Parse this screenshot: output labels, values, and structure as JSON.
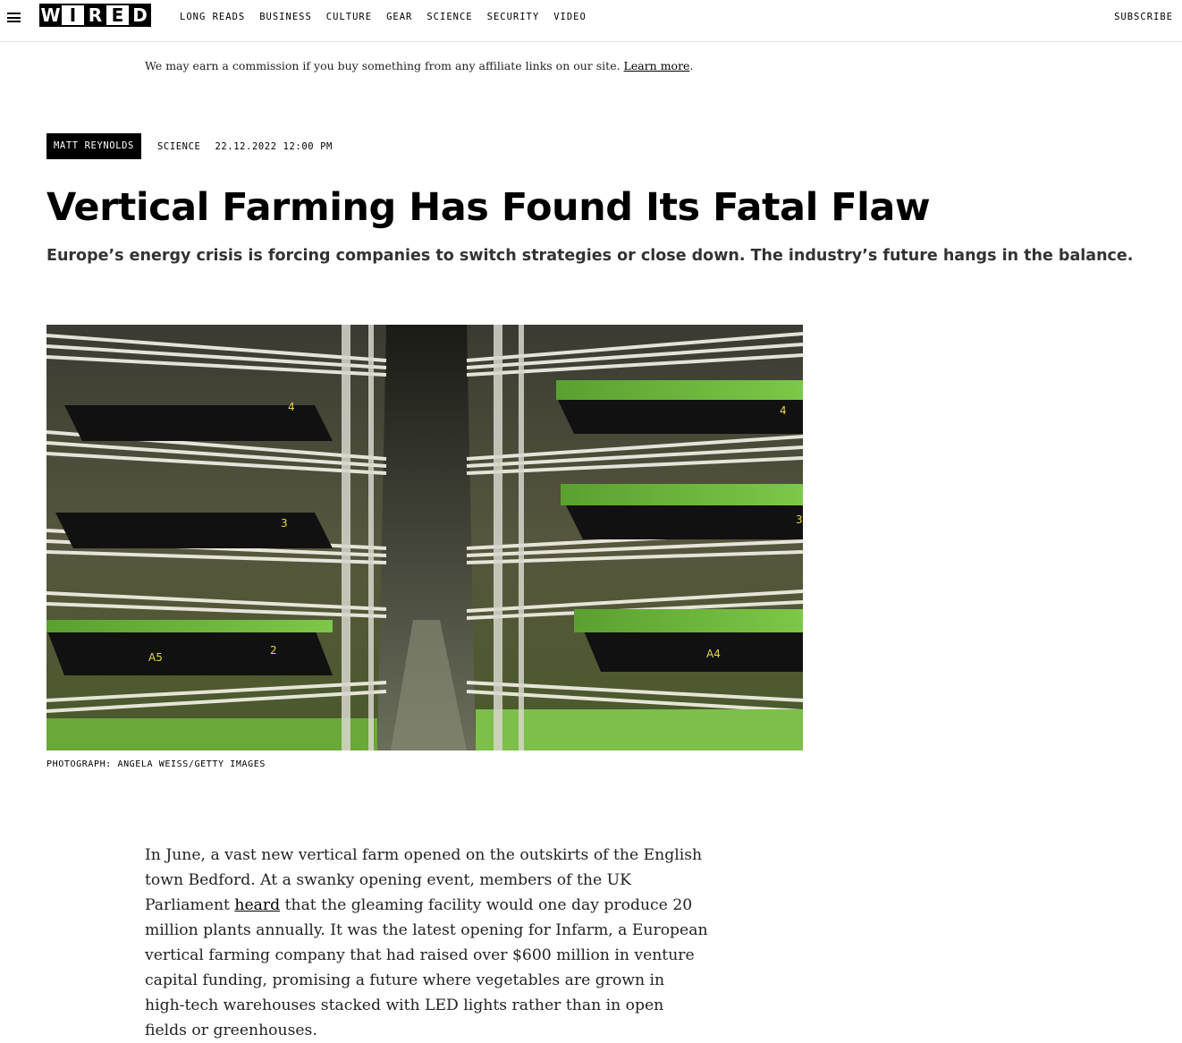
{
  "nav": {
    "menu_icon": "hamburger-icon",
    "logo_letters": [
      "W",
      "I",
      "R",
      "E",
      "D"
    ],
    "items": [
      "LONG READS",
      "BUSINESS",
      "CULTURE",
      "GEAR",
      "SCIENCE",
      "SECURITY",
      "VIDEO"
    ],
    "subscribe": "SUBSCRIBE"
  },
  "affiliate": {
    "text": "We may earn a commission if you buy something from any affiliate links on our site.",
    "link": "Learn more",
    "end": "."
  },
  "article": {
    "author": "MATT REYNOLDS",
    "rubric": "SCIENCE",
    "date": "22.12.2022 12:00 PM",
    "title": "Vertical Farming Has Found Its Fatal Flaw",
    "dek": "Europe’s energy crisis is forcing companies to switch strategies or close down. The industry’s future hangs in the balance.",
    "caption": "PHOTOGRAPH: ANGELA WEISS/GETTY IMAGES",
    "body_before": "In June, a vast new vertical farm opened on the outskirts of the English town Bedford. At a swanky opening event, members of the UK Parliament ",
    "body_link": "heard",
    "body_after": " that the gleaming facility would one day produce 20 million plants annually. It was the latest opening for Infarm, a European vertical farming company that had raised over $600 million in venture capital funding, promising a future where vegetables are grown in high-tech warehouses stacked with LED lights rather than in open fields or greenhouses."
  },
  "hero_labels": [
    "4",
    "3",
    "2",
    "A5",
    "4",
    "3",
    "A4"
  ]
}
